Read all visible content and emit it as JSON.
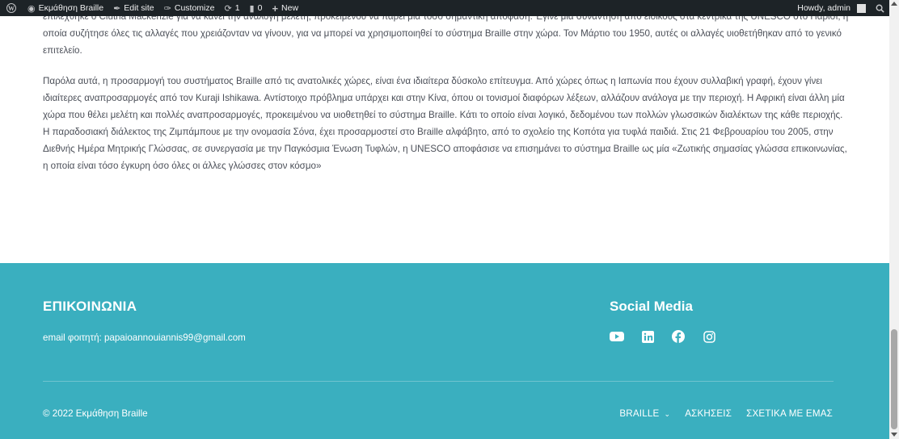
{
  "admin_bar": {
    "site_name": "Εκμάθηση Braille",
    "edit_site": "Edit site",
    "customize": "Customize",
    "updates_count": "1",
    "comments_count": "0",
    "new_label": "New",
    "howdy": "Howdy, admin"
  },
  "article": {
    "paragraph_1": "επιλέχθηκε ο Clutha Mackenzie για να κάνει την ανάλογη μελέτη, προκειμένου να πάρει μία τόσο σημαντική απόφαση. Έγινε μία συνάντηση από ειδικούς στα κεντρικά της UNESCO στο Παρίσι, η οποία συζήτησε όλες τις αλλαγές που χρειάζονταν να γίνουν, για να μπορεί να χρησιμοποιηθεί το σύστημα Braille στην χώρα. Τον Μάρτιο του 1950, αυτές οι αλλαγές υιοθετήθηκαν από το γενικό επιτελείο.",
    "paragraph_2": "Παρόλα αυτά, η προσαρμογή του συστήματος Braille από τις ανατολικές χώρες, είναι ένα ιδιαίτερα δύσκολο επίτευγμα. Από χώρες όπως η Ιαπωνία που έχουν συλλαβική γραφή, έχουν γίνει ιδιαίτερες αναπροσαρμογές από τον Kuraji Ishikawa. Αντίστοιχο πρόβλημα υπάρχει και στην Κίνα, όπου οι τονισμοί διαφόρων λέξεων, αλλάζουν ανάλογα με την περιοχή. Η Αφρική είναι άλλη μία χώρα που θέλει μελέτη και πολλές αναπροσαρμογές, προκειμένου να υιοθετηθεί το σύστημα Braille. Κάτι το οποίο είναι λογικό, δεδομένου των πολλών γλωσσικών διαλέκτων της κάθε περιοχής. Η παραδοσιακή διάλεκτος της Ζιμπάμπουε με την ονομασία Σόνα, έχει προσαρμοστεί στο Braille αλφάβητο, από το σχολείο της Κοπότα για τυφλά παιδιά. Στις 21 Φεβρουαρίου του 2005, στην Διεθνής Ημέρα Μητρικής Γλώσσας, σε συνεργασία με την Παγκόσμια Ένωση Τυφλών, η UNESCO αποφάσισε να επισημάνει το σύστημα Braille ως μία «Ζωτικής σημασίας γλώσσα επικοινωνίας, η οποία είναι τόσο έγκυρη όσο όλες οι άλλες γλώσσες στον κόσμο»"
  },
  "footer": {
    "contact_heading": "ΕΠΙΚΟΙΝΩΝΙΑ",
    "contact_email": "email φοιτητή: papaioannouiannis99@gmail.com",
    "social_heading": "Social Media",
    "social_icons": [
      "youtube-icon",
      "linkedin-icon",
      "facebook-icon",
      "instagram-icon"
    ],
    "copyright": "© 2022 Εκμάθηση Braille",
    "nav": {
      "braille": "BRAILLE",
      "exercises": "ΑΣΚΗΣΕΙΣ",
      "about": "ΣΧΕΤΙΚΑ ΜΕ ΕΜΑΣ"
    }
  },
  "colors": {
    "admin_bar_bg": "#1d2327",
    "footer_bg": "#3aafbf",
    "footer_text": "#ffffff",
    "body_text": "#4b4f58"
  }
}
